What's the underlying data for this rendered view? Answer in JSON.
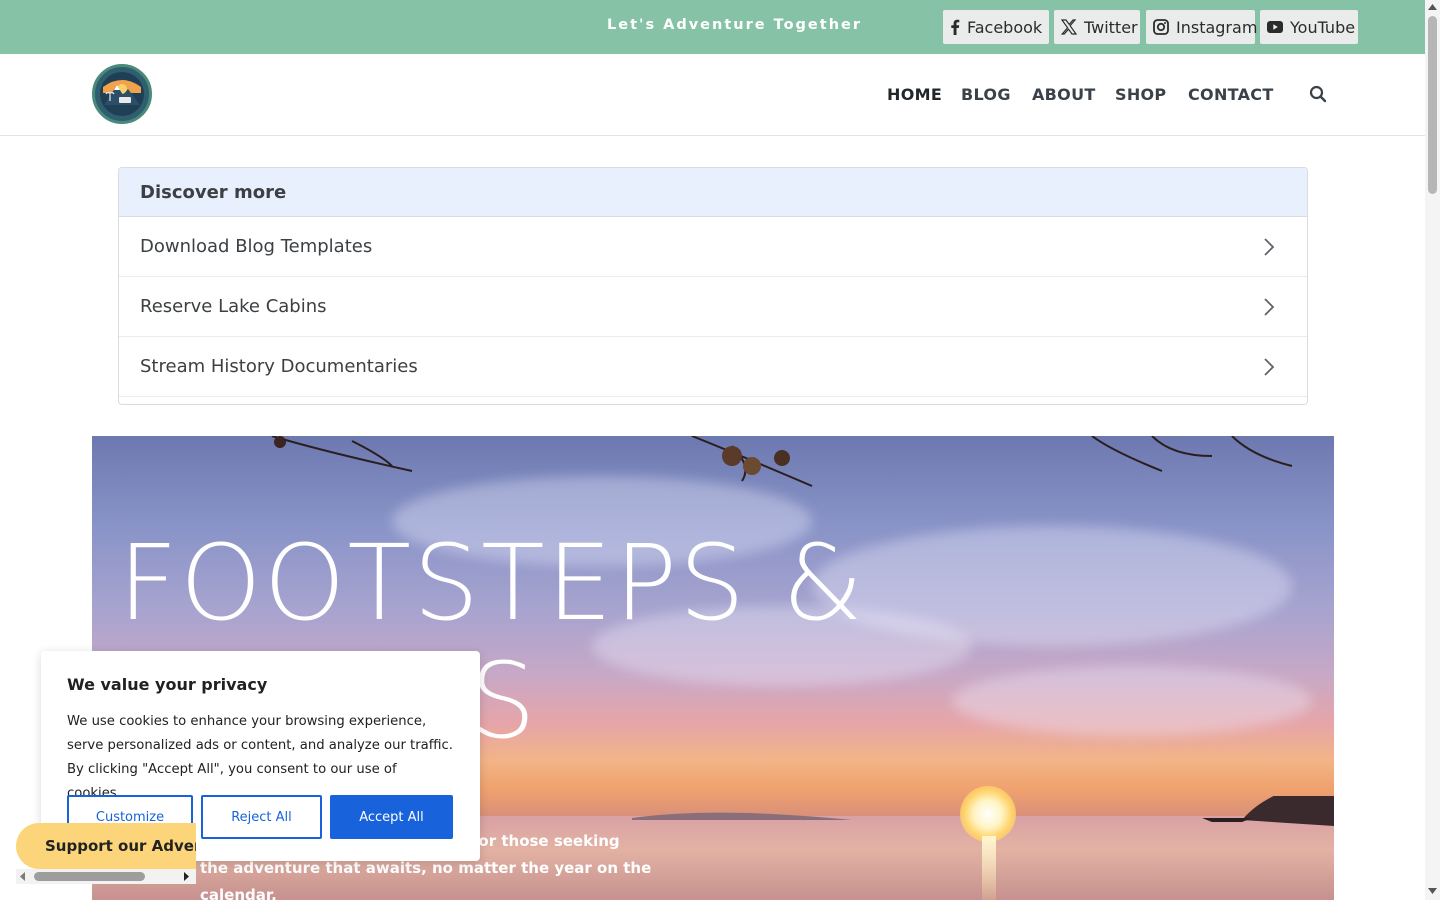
{
  "topbar": {
    "tagline": "Let's Adventure Together",
    "social": [
      {
        "label": "Facebook",
        "icon": "facebook-icon"
      },
      {
        "label": "Twitter",
        "icon": "x-twitter-icon"
      },
      {
        "label": "Instagram",
        "icon": "instagram-icon"
      },
      {
        "label": "YouTube",
        "icon": "youtube-icon"
      }
    ]
  },
  "nav": {
    "items": [
      "HOME",
      "BLOG",
      "ABOUT",
      "SHOP",
      "CONTACT"
    ],
    "active": "HOME"
  },
  "discover": {
    "title": "Discover more",
    "items": [
      "Download Blog Templates",
      "Reserve Lake Cabins",
      "Stream History Documentaries"
    ]
  },
  "hero": {
    "title_line1": "FOOTSTEPS &",
    "title_line2": "TRACKS",
    "subtitle_line1": "Inspiration and encouragement for those seeking",
    "subtitle_line2": "the adventure that awaits, no matter the year on the calendar."
  },
  "cookie": {
    "title": "We value your privacy",
    "text": "We use cookies to enhance your browsing experience, serve personalized ads or content, and analyze our traffic. By clicking \"Accept All\", you consent to our use of cookies.",
    "customize": "Customize",
    "reject": "Reject All",
    "accept": "Accept All"
  },
  "kofi": {
    "label": "Support our Adventures"
  },
  "colors": {
    "topbar": "#86c3a6",
    "accent_blue": "#1863dc",
    "discover_head": "#e8f0fe",
    "kofi": "#fcd57a"
  }
}
